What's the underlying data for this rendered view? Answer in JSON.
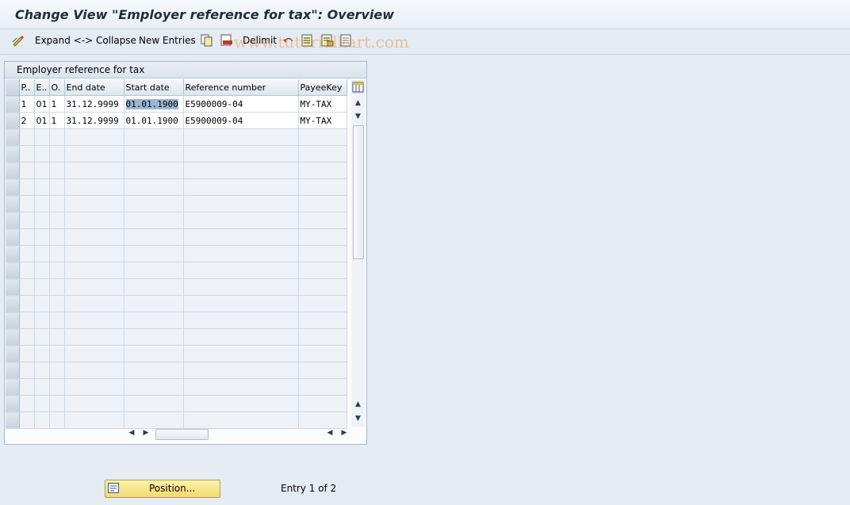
{
  "title": "Change View \"Employer reference for tax\": Overview",
  "toolbar": {
    "expand_collapse": "Expand <-> Collapse",
    "new_entries": "New Entries",
    "delimit": "Delimit",
    "watermark": "www.tutorialkart.com"
  },
  "panel": {
    "title": "Employer reference for tax",
    "columns": [
      "P..",
      "E..",
      "O.",
      "End date",
      "Start date",
      "Reference number",
      "PayeeKey"
    ],
    "rows": [
      [
        "1",
        "01",
        "1",
        "31.12.9999",
        "01.01.1900",
        "E5900009-04",
        "MY-TAX"
      ],
      [
        "2",
        "01",
        "1",
        "31.12.9999",
        "01.01.1900",
        "E5900009-04",
        "MY-TAX"
      ]
    ]
  },
  "footer": {
    "position_label": "Position...",
    "entry_text": "Entry 1 of 2"
  }
}
